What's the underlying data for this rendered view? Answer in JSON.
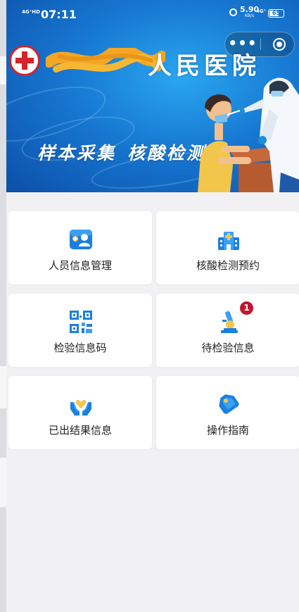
{
  "status_bar": {
    "network_left": "4G⁺HD",
    "time": "07:11",
    "speed_value": "5.90",
    "speed_unit": "KB/s",
    "network_right": "4G⁺",
    "battery": "65"
  },
  "capsule": {
    "more_label": "•••"
  },
  "banner": {
    "hospital_name_visible": "人民医院",
    "left_text": "样本采集",
    "right_text": "核酸检测"
  },
  "menu": [
    {
      "label": "人员信息管理",
      "icon": "person-card-icon",
      "badge": ""
    },
    {
      "label": "核酸检测预约",
      "icon": "hospital-building-icon",
      "badge": ""
    },
    {
      "label": "检验信息码",
      "icon": "qr-code-icon",
      "badge": ""
    },
    {
      "label": "待检验信息",
      "icon": "microscope-icon",
      "badge": "1"
    },
    {
      "label": "已出结果信息",
      "icon": "hands-heart-icon",
      "badge": ""
    },
    {
      "label": "操作指南",
      "icon": "tag-icon",
      "badge": ""
    }
  ],
  "colors": {
    "banner_blue": "#1778d2",
    "cross_red": "#d5232b",
    "badge_red": "#c2152e",
    "icon_blue": "#1a7fe0"
  }
}
